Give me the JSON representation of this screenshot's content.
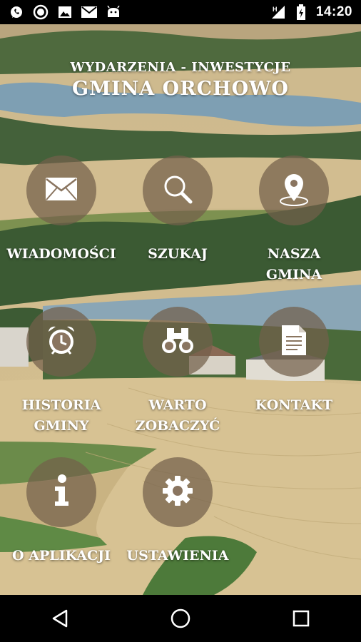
{
  "status_bar": {
    "time": "14:20",
    "left_icons": [
      "whatsapp-icon",
      "chat-bubble-icon",
      "image-icon",
      "email-icon",
      "android-icon"
    ],
    "right_icons": [
      "signal-h-icon",
      "battery-charging-icon"
    ]
  },
  "header": {
    "subtitle": "WYDARZENIA - INWESTYCJE",
    "title": "GMINA ORCHOWO"
  },
  "menu": {
    "messages": {
      "label": "WIADOMOŚCI",
      "icon": "envelope-icon"
    },
    "search": {
      "label": "SZUKAJ",
      "icon": "search-icon"
    },
    "our_commune": {
      "label": "NASZA\nGMINA",
      "icon": "map-pin-icon"
    },
    "history": {
      "label": "HISTORIA\nGMINY",
      "icon": "alarm-clock-icon"
    },
    "worth_seeing": {
      "label": "WARTO\nZOBACZYĆ",
      "icon": "binoculars-icon"
    },
    "contact": {
      "label": "KONTAKT",
      "icon": "document-icon"
    },
    "about": {
      "label": "O APLIKACJI",
      "icon": "info-icon"
    },
    "settings": {
      "label": "USTAWIENIA",
      "icon": "gear-icon"
    }
  },
  "colors": {
    "circle_bg": "#735f4b",
    "text": "#ffffff",
    "bars": "#000000"
  },
  "nav_bar": {
    "icons": [
      "back-icon",
      "home-icon",
      "recents-icon"
    ]
  }
}
